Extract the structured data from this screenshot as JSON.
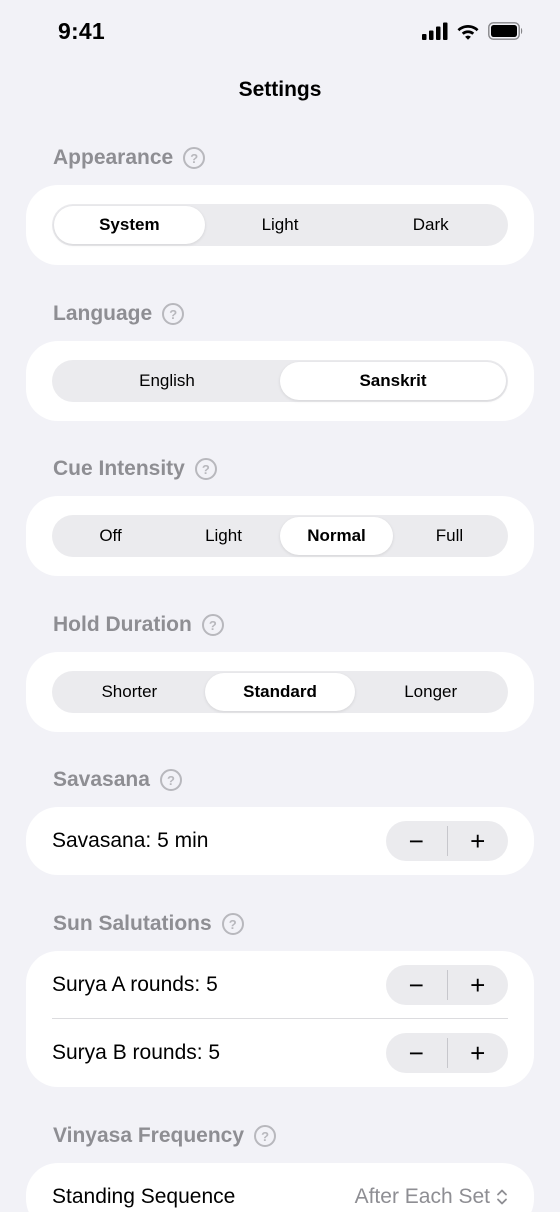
{
  "status_bar": {
    "time": "9:41"
  },
  "nav": {
    "title": "Settings"
  },
  "appearance": {
    "header": "Appearance",
    "options": [
      "System",
      "Light",
      "Dark"
    ],
    "selected": "System"
  },
  "language": {
    "header": "Language",
    "options": [
      "English",
      "Sanskrit"
    ],
    "selected": "Sanskrit"
  },
  "cue_intensity": {
    "header": "Cue Intensity",
    "options": [
      "Off",
      "Light",
      "Normal",
      "Full"
    ],
    "selected": "Normal"
  },
  "hold_duration": {
    "header": "Hold Duration",
    "options": [
      "Shorter",
      "Standard",
      "Longer"
    ],
    "selected": "Standard"
  },
  "savasana": {
    "header": "Savasana",
    "row_label": "Savasana: 5 min"
  },
  "sun_salutations": {
    "header": "Sun Salutations",
    "surya_a_label": "Surya A rounds: 5",
    "surya_b_label": "Surya B rounds: 5"
  },
  "vinyasa_frequency": {
    "header": "Vinyasa Frequency",
    "standing_label": "Standing Sequence",
    "standing_value": "After Each Set"
  },
  "stepper": {
    "minus": "−",
    "plus": "+"
  },
  "help_glyph": "?",
  "colors": {
    "background": "#f2f2f7",
    "card": "#ffffff",
    "segment_track": "#ebebee",
    "secondary_text": "#8e8e93"
  }
}
